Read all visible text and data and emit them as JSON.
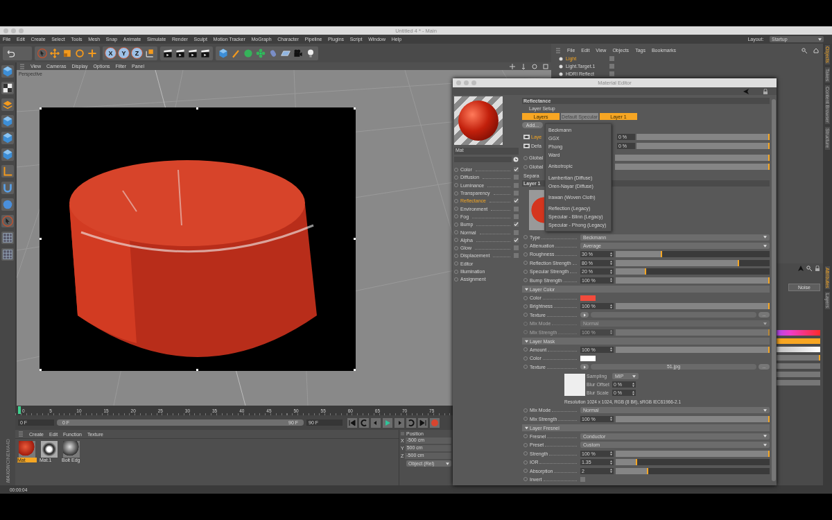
{
  "window": {
    "title": "Untitled 4 * - Main"
  },
  "menu": [
    "File",
    "Edit",
    "Create",
    "Select",
    "Tools",
    "Mesh",
    "Snap",
    "Animate",
    "Simulate",
    "Render",
    "Sculpt",
    "Motion Tracker",
    "MoGraph",
    "Character",
    "Pipeline",
    "Plugins",
    "Script",
    "Window",
    "Help"
  ],
  "layout": {
    "label": "Layout:",
    "value": "Startup"
  },
  "axis_buttons": [
    "X",
    "Y",
    "Z"
  ],
  "viewport": {
    "menu": [
      "View",
      "Cameras",
      "Display",
      "Options",
      "Filter",
      "Panel"
    ],
    "camera": "Perspective"
  },
  "timeline": {
    "ticks": [
      "0",
      "5",
      "10",
      "15",
      "20",
      "25",
      "30",
      "35",
      "40",
      "45",
      "50",
      "55",
      "60",
      "65",
      "70",
      "75"
    ],
    "current": "0 F",
    "range_start": "0 F",
    "range_end": "90 F",
    "end": "90 F"
  },
  "material_manager": {
    "menu": [
      "Create",
      "Edit",
      "Function",
      "Texture"
    ],
    "materials": [
      {
        "name": "Mat",
        "selected": true
      },
      {
        "name": "Mat.1",
        "selected": false
      },
      {
        "name": "Bolt Edg",
        "selected": false
      }
    ]
  },
  "coordinates": {
    "title": "Position",
    "fields": [
      {
        "axis": "X",
        "value": "-500 cm"
      },
      {
        "axis": "Y",
        "value": "500 cm"
      },
      {
        "axis": "Z",
        "value": "-500 cm"
      }
    ],
    "mode": "Object (Rel)"
  },
  "logo": {
    "brand": "MAXON",
    "product": "CINEMA4D"
  },
  "status_bar": "00:00:04",
  "object_manager": {
    "menu": [
      "File",
      "Edit",
      "View",
      "Objects",
      "Tags",
      "Bookmarks"
    ],
    "objects": [
      {
        "name": "Light",
        "selected": true
      },
      {
        "name": "Light.Target.1",
        "selected": false
      },
      {
        "name": "HDRI Reflect",
        "selected": false
      }
    ]
  },
  "attributes": {
    "button": "Noise",
    "slider": {
      "level": 1
    }
  },
  "side_tabs": [
    {
      "label": "Objects",
      "selected": true
    },
    {
      "label": "Takes",
      "selected": false
    },
    {
      "label": "Content Browser",
      "selected": false
    },
    {
      "label": "Structure",
      "selected": false
    }
  ],
  "side_tabs_lower": [
    {
      "label": "Attributes",
      "selected": true
    },
    {
      "label": "Layers",
      "selected": false
    }
  ],
  "material_editor": {
    "title": "Material Editor",
    "material_name": "Mat",
    "channels": [
      {
        "label": "Color",
        "kind": "toggle",
        "checked": true,
        "selected": false
      },
      {
        "label": "Diffusion",
        "kind": "toggle",
        "checked": false,
        "selected": false
      },
      {
        "label": "Luminance",
        "kind": "toggle",
        "checked": false,
        "selected": false
      },
      {
        "label": "Transparency",
        "kind": "toggle",
        "checked": false,
        "selected": false
      },
      {
        "label": "Reflectance",
        "kind": "toggle",
        "checked": true,
        "selected": true
      },
      {
        "label": "Environment",
        "kind": "toggle",
        "checked": false,
        "selected": false
      },
      {
        "label": "Fog",
        "kind": "toggle",
        "checked": false,
        "selected": false
      },
      {
        "label": "Bump",
        "kind": "toggle",
        "checked": true,
        "selected": false
      },
      {
        "label": "Normal",
        "kind": "toggle",
        "checked": false,
        "selected": false
      },
      {
        "label": "Alpha",
        "kind": "toggle",
        "checked": true,
        "selected": false
      },
      {
        "label": "Glow",
        "kind": "toggle",
        "checked": false,
        "selected": false
      },
      {
        "label": "Displacement",
        "kind": "toggle",
        "checked": false,
        "selected": false
      },
      {
        "label": "Editor",
        "kind": "page",
        "selected": false
      },
      {
        "label": "Illumination",
        "kind": "page",
        "selected": false
      },
      {
        "label": "Assignment",
        "kind": "page",
        "selected": false
      }
    ],
    "section_title": "Reflectance",
    "layer_setup": "Layer Setup",
    "layer_tabs": [
      {
        "label": "Layers",
        "selected": true
      },
      {
        "label": "Default Specular",
        "selected": false
      },
      {
        "label": "Layer 1",
        "selected": true
      }
    ],
    "add_button": "Add...",
    "layer_list": [
      {
        "label": "Laye",
        "value": "0 %",
        "selected": true,
        "level": 1
      },
      {
        "label": "Defa",
        "value": "0 %",
        "selected": false,
        "level": 1
      }
    ],
    "global_rows": [
      {
        "label": "Global",
        "level": 1
      },
      {
        "label": "Global",
        "level": 1
      }
    ],
    "separate_label": "Separa",
    "add_menu": [
      [
        "Beckmann",
        "GGX",
        "Phong",
        "Ward"
      ],
      [
        "Anisotropic"
      ],
      [
        "Lambertian (Diffuse)",
        "Oren-Nayar (Diffuse)"
      ],
      [
        "Irawan (Woven Cloth)"
      ],
      [
        "Reflection (Legacy)",
        "Specular - Blinn (Legacy)",
        "Specular - Phong (Legacy)"
      ]
    ],
    "layer_title": "Layer 1",
    "layer_params": [
      {
        "kind": "dropdown",
        "label": "Type",
        "value": "Beckmann"
      },
      {
        "kind": "dropdown",
        "label": "Attenuation",
        "value": "Average"
      },
      {
        "kind": "slider",
        "label": "Roughness",
        "value": "30 %",
        "level": 0.3
      },
      {
        "kind": "slider",
        "label": "Reflection Strength",
        "value": "80 %",
        "level": 0.8
      },
      {
        "kind": "slider",
        "label": "Specular Strength",
        "value": "20 %",
        "level": 0.2
      },
      {
        "kind": "slider",
        "label": "Bump Strength",
        "value": "100 %",
        "level": 1
      }
    ],
    "groups": [
      {
        "title": "Layer Color",
        "expanded": true,
        "rows": [
          {
            "kind": "color",
            "label": "Color",
            "color": "#f24b3c",
            "disabled": false
          },
          {
            "kind": "slider",
            "label": "Brightness",
            "value": "100 %",
            "level": 1,
            "disabled": false
          },
          {
            "kind": "texture",
            "label": "Texture",
            "browse": "...",
            "disabled": false
          },
          {
            "kind": "dropdown",
            "label": "Mix Mode",
            "value": "Normal",
            "disabled": true
          },
          {
            "kind": "slider",
            "label": "Mix Strength",
            "value": "100 %",
            "level": 1,
            "disabled": true
          }
        ]
      },
      {
        "title": "Layer Mask",
        "expanded": true,
        "rows": [
          {
            "kind": "slider",
            "label": "Amount",
            "value": "100 %",
            "level": 1
          },
          {
            "kind": "color",
            "label": "Color",
            "color": "#ffffff"
          },
          {
            "kind": "texture",
            "label": "Texture",
            "file": "51.jpg",
            "browse": "..."
          },
          {
            "kind": "sampling",
            "settings": [
              {
                "kind": "dropdown",
                "label": "Sampling",
                "value": "MIP"
              },
              {
                "kind": "number",
                "label": "Blur Offset",
                "value": "0 %"
              },
              {
                "kind": "number",
                "label": "Blur Scale",
                "value": "0 %"
              }
            ]
          },
          {
            "kind": "note",
            "text": "Resolution 1024 x 1024, RGB (8 Bit), sRGB IEC61966-2.1"
          },
          {
            "kind": "dropdown",
            "label": "Mix Mode",
            "value": "Normal"
          },
          {
            "kind": "slider",
            "label": "Mix Strength",
            "value": "100 %",
            "level": 1
          }
        ]
      },
      {
        "title": "Layer Fresnel",
        "expanded": true,
        "rows": [
          {
            "kind": "dropdown",
            "label": "Fresnel",
            "value": "Conductor"
          },
          {
            "kind": "dropdown",
            "label": "Preset",
            "value": "Custom"
          },
          {
            "kind": "slider",
            "label": "Strength",
            "value": "100 %",
            "level": 1
          },
          {
            "kind": "slider",
            "label": "IOR",
            "value": "1.35",
            "level": 0.14
          },
          {
            "kind": "slider",
            "label": "Absorption",
            "value": "2",
            "level": 0.21
          },
          {
            "kind": "checkbox",
            "label": "Invert",
            "checked": false
          }
        ]
      }
    ]
  }
}
